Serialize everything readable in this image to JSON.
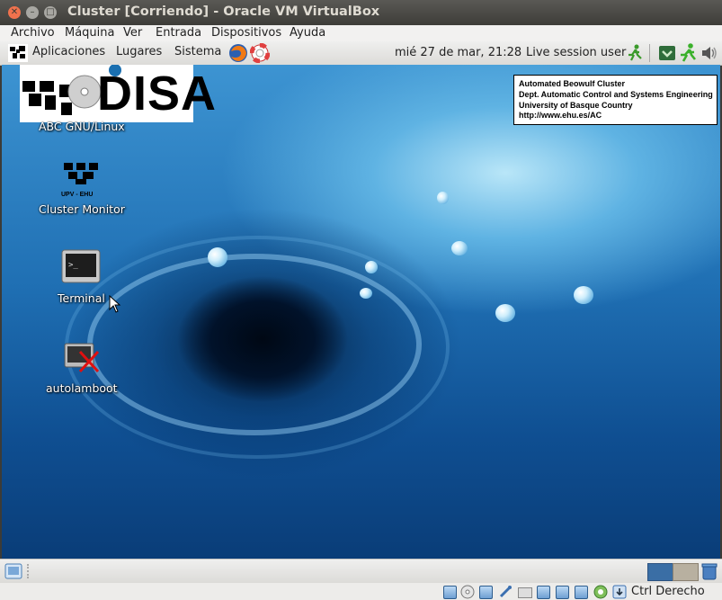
{
  "window": {
    "title": "Cluster [Corriendo] - Oracle VM VirtualBox"
  },
  "vbox_menu": {
    "items": [
      "Archivo",
      "Máquina",
      "Ver",
      "Entrada",
      "Dispositivos",
      "Ayuda"
    ]
  },
  "guest_panel": {
    "menus": [
      "Aplicaciones",
      "Lugares",
      "Sistema"
    ],
    "clock": "mié 27 de mar, 21:28",
    "user": "Live session user"
  },
  "desktop_icons": [
    {
      "label": "ABC GNU/Linux",
      "icon": "disa-logo-icon",
      "logo_text": "DISA"
    },
    {
      "label": "Cluster Monitor",
      "icon": "upv-ehu-logo-icon",
      "logo_text": "UPV - EHU"
    },
    {
      "label": "Terminal",
      "icon": "terminal-icon"
    },
    {
      "label": "autolamboot",
      "icon": "autolamboot-icon"
    }
  ],
  "info_box": {
    "lines": [
      "Automated Beowulf Cluster",
      "Dept. Automatic Control and Systems Engineering",
      "University of Basque Country",
      "http://www.ehu.es/AC"
    ]
  },
  "statusbar": {
    "host_key": "Ctrl Derecho"
  },
  "colors": {
    "ubuntu_title_bg": "#3c3b37",
    "close_button": "#f0724d",
    "panel_bg": "#e8e7e4",
    "desktop_blue": "#1f6fb3"
  }
}
